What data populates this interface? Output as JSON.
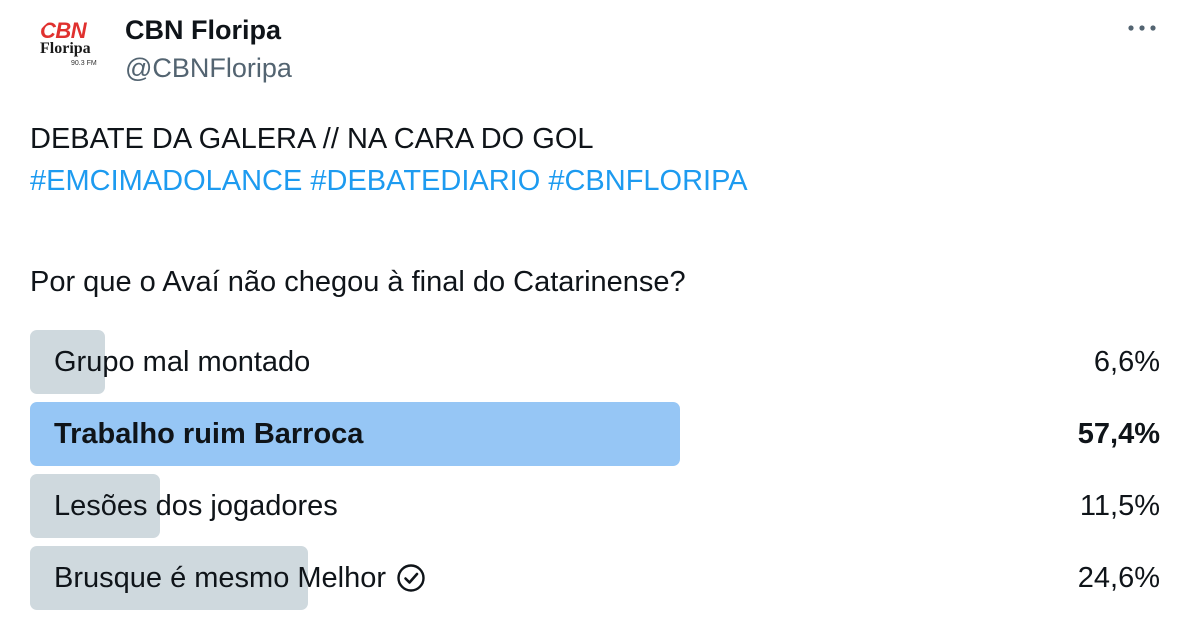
{
  "account": {
    "display_name": "CBN Floripa",
    "handle": "@CBNFloripa",
    "avatar": {
      "logo_text": "CBN",
      "logo_city": "Floripa",
      "logo_freq": "90.3 FM",
      "logo_color": "#e0312f"
    },
    "more_icon": "more-horizontal-icon"
  },
  "tweet": {
    "line1": "DEBATE DA GALERA // NA CARA DO GOL",
    "hashtags": [
      "#EMCIMADOLANCE",
      "#DEBATEDIARIO",
      "#CBNFLORIPA"
    ],
    "question": "Por que o Avaí não chegou à final do Catarinense?"
  },
  "poll": {
    "options": [
      {
        "label": "Grupo mal montado",
        "percent_text": "6,6%",
        "fraction": 0.066,
        "winner": false
      },
      {
        "label": "Trabalho ruim Barroca",
        "percent_text": "57,4%",
        "fraction": 0.574,
        "winner": true
      },
      {
        "label": "Lesões dos jogadores",
        "percent_text": "11,5%",
        "fraction": 0.115,
        "winner": false
      },
      {
        "label": "Brusque é mesmo Melhor",
        "percent_text": "24,6%",
        "fraction": 0.246,
        "winner": false,
        "icon": "check-circle-icon"
      }
    ],
    "colors": {
      "winner_bar": "#96c6f5",
      "other_bar": "#cfd9de",
      "hashtag": "#1d9bf0"
    }
  }
}
